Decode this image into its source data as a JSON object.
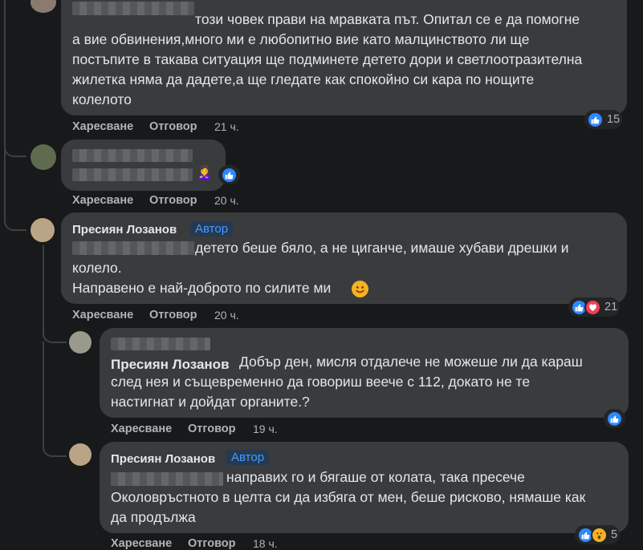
{
  "labels": {
    "like": "Харесване",
    "reply": "Отговор",
    "author_badge": "Автор"
  },
  "comments": [
    {
      "lines": [
        "този човек прави на мравката път. Опитал се е да помогне",
        "а вие обвинения,много ми е любопитно вие като малцинството ли ще",
        "постъпите в такава ситуация ще подминете детето дори и светлоотразителна",
        "жилетка няма да дадете,а ще гледате как спокойно си кара по нощите",
        "колелото"
      ],
      "time": "21 ч.",
      "reactions": [
        "like"
      ],
      "reaction_count": "15"
    },
    {
      "emoji": "🙎‍♀️",
      "time": "20 ч.",
      "reactions": [
        "like"
      ]
    },
    {
      "author": "Пресиян Лозанов",
      "is_author": true,
      "lines": [
        "детето беше бяло, а не циганче, имаше хубави дрешки и",
        "колело.",
        "Направено е най-доброто по силите ми"
      ],
      "time": "20 ч.",
      "reactions": [
        "like",
        "love"
      ],
      "reaction_count": "21"
    },
    {
      "mention": "Пресиян Лозанов",
      "lines": [
        "Добър ден, мисля отдалече не можеше ли да караш",
        "след нея и същевременно да говориш веече с 112, докато не те",
        "настигнат и дойдат органите.?"
      ],
      "time": "19 ч.",
      "reactions": [
        "like"
      ]
    },
    {
      "author": "Пресиян Лозанов",
      "is_author": true,
      "lines": [
        "направих го и бягаше от колата, така пресече",
        "Околовръстното в целта си да избяга от мен, беше рисково, нямаше как",
        "да продължа"
      ],
      "time": "18 ч.",
      "reactions": [
        "like",
        "wow"
      ],
      "reaction_count": "5"
    }
  ],
  "colors": {
    "background": "#18191a",
    "bubble": "#3a3b3c",
    "like": "#2d88ff",
    "love": "#f33e58",
    "wow": "#f7b125",
    "author_badge": "#4599ff"
  },
  "icons": {
    "like": "thumbs-up-icon",
    "love": "heart-icon",
    "wow": "wow-face-icon",
    "smile": "smiling-face-icon"
  }
}
